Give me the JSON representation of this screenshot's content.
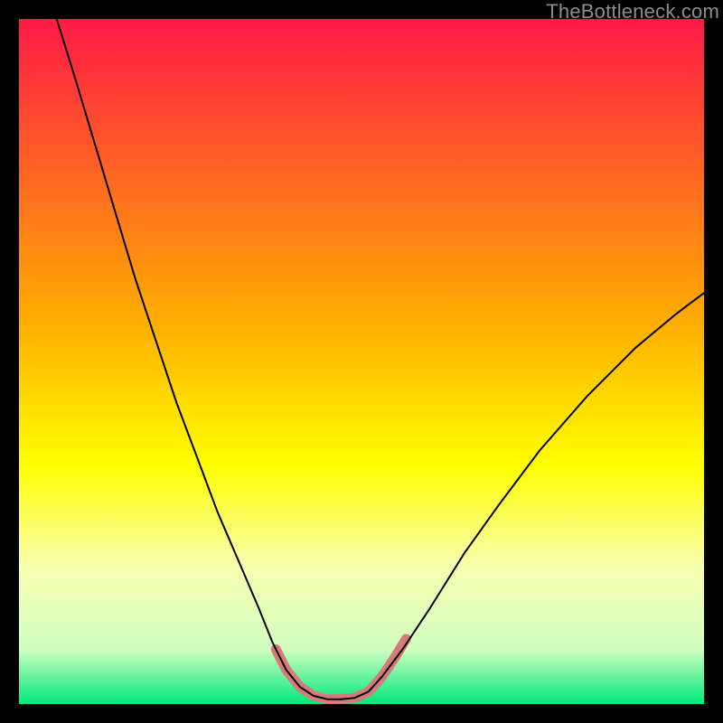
{
  "watermark": "TheBottleneck.com",
  "chart_data": {
    "type": "line",
    "title": "",
    "xlabel": "",
    "ylabel": "",
    "xlim": [
      0,
      100
    ],
    "ylim": [
      0,
      100
    ],
    "gradient_stops": [
      {
        "offset": 0,
        "color": "#ff1a46"
      },
      {
        "offset": 45,
        "color": "#ffb000"
      },
      {
        "offset": 65,
        "color": "#ffff00"
      },
      {
        "offset": 80,
        "color": "#f8ffb0"
      },
      {
        "offset": 92,
        "color": "#d0ffc0"
      },
      {
        "offset": 100,
        "color": "#00e87a"
      }
    ],
    "series": [
      {
        "name": "left-curve",
        "stroke": "#000000",
        "points": [
          {
            "x": 5.5,
            "y": 100
          },
          {
            "x": 8,
            "y": 92
          },
          {
            "x": 11,
            "y": 82
          },
          {
            "x": 14,
            "y": 72
          },
          {
            "x": 17,
            "y": 62
          },
          {
            "x": 20,
            "y": 53
          },
          {
            "x": 23,
            "y": 44
          },
          {
            "x": 26,
            "y": 36
          },
          {
            "x": 29,
            "y": 28
          },
          {
            "x": 32,
            "y": 21
          },
          {
            "x": 35,
            "y": 14
          },
          {
            "x": 37,
            "y": 9
          },
          {
            "x": 39,
            "y": 5
          },
          {
            "x": 41,
            "y": 2.5
          },
          {
            "x": 43,
            "y": 1.2
          },
          {
            "x": 45,
            "y": 0.7
          },
          {
            "x": 47,
            "y": 0.7
          }
        ]
      },
      {
        "name": "right-curve",
        "stroke": "#000000",
        "points": [
          {
            "x": 47,
            "y": 0.7
          },
          {
            "x": 49,
            "y": 0.9
          },
          {
            "x": 51,
            "y": 1.8
          },
          {
            "x": 53,
            "y": 4
          },
          {
            "x": 56,
            "y": 8
          },
          {
            "x": 60,
            "y": 14
          },
          {
            "x": 65,
            "y": 22
          },
          {
            "x": 70,
            "y": 29
          },
          {
            "x": 76,
            "y": 37
          },
          {
            "x": 83,
            "y": 45
          },
          {
            "x": 90,
            "y": 52
          },
          {
            "x": 96,
            "y": 57
          },
          {
            "x": 100,
            "y": 60
          }
        ]
      },
      {
        "name": "highlight-segment",
        "stroke": "#d87a7a",
        "stroke_width": 11,
        "points": [
          {
            "x": 37.5,
            "y": 8
          },
          {
            "x": 39,
            "y": 5
          },
          {
            "x": 41,
            "y": 2.5
          },
          {
            "x": 43,
            "y": 1.2
          },
          {
            "x": 45,
            "y": 0.7
          },
          {
            "x": 47,
            "y": 0.7
          },
          {
            "x": 49,
            "y": 0.9
          },
          {
            "x": 51,
            "y": 1.8
          },
          {
            "x": 53,
            "y": 4
          },
          {
            "x": 55,
            "y": 7
          },
          {
            "x": 56.5,
            "y": 9.5
          }
        ]
      }
    ]
  }
}
